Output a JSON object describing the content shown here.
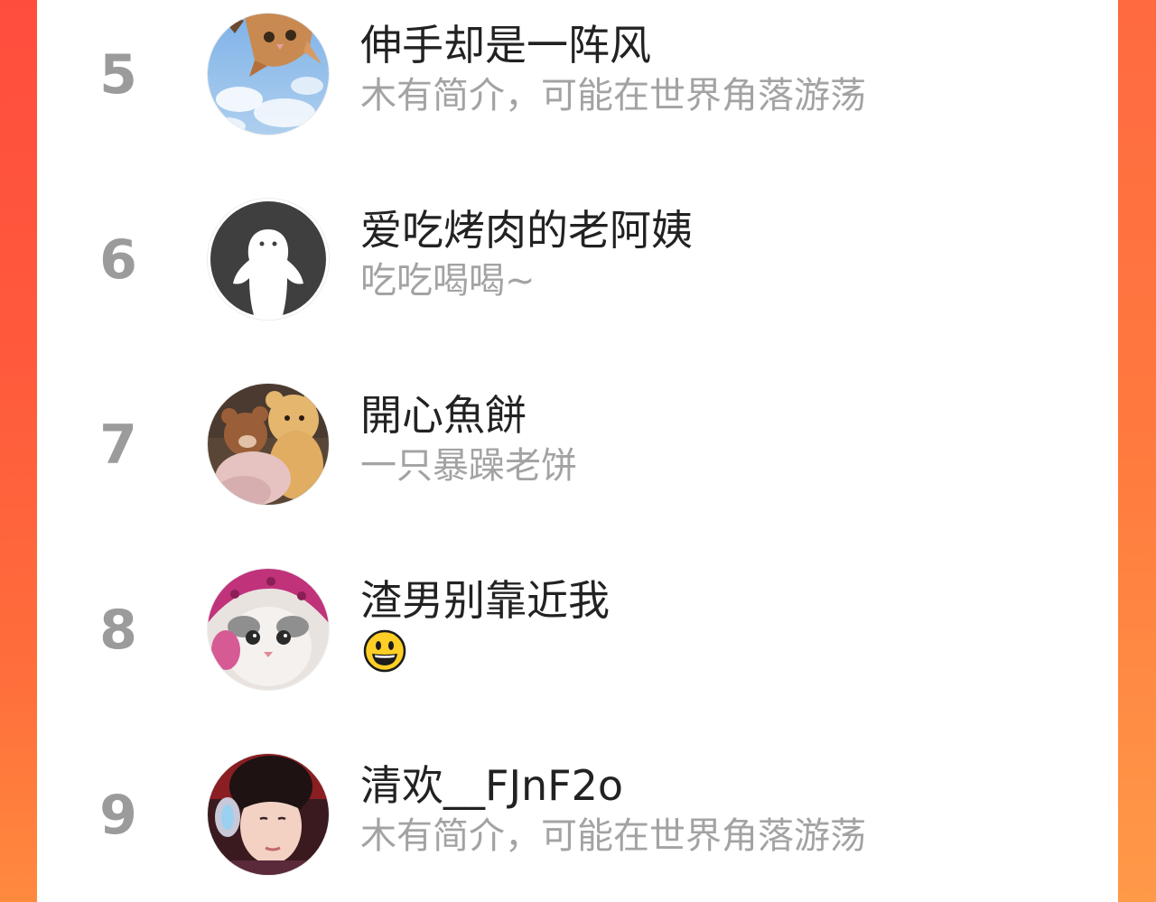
{
  "ranking": {
    "items": [
      {
        "rank": "5",
        "name": "伸手却是一阵风",
        "bio": "木有简介，可能在世界角落游荡",
        "avatar_icon": "cat-sky-avatar-icon"
      },
      {
        "rank": "6",
        "name": "爱吃烤肉的老阿姨",
        "bio": "吃吃喝喝~",
        "avatar_icon": "default-ghost-avatar-icon"
      },
      {
        "rank": "7",
        "name": "開心魚餅",
        "bio": "一只暴躁老饼",
        "avatar_icon": "teddy-bears-avatar-icon"
      },
      {
        "rank": "8",
        "name": "渣男别靠近我",
        "bio": "",
        "bio_emoji_icon": "grinning-face-emoji-icon",
        "avatar_icon": "cat-pink-hat-avatar-icon"
      },
      {
        "rank": "9",
        "name": "清欢__FJnF2o",
        "bio": "木有简介，可能在世界角落游荡",
        "avatar_icon": "girl-headphones-avatar-icon"
      }
    ]
  },
  "colors": {
    "accent_gradient_top": "#ff4d3d",
    "accent_gradient_bottom": "#ff8a3e",
    "rank_gray": "#9b9b9b",
    "name_text": "#222222",
    "bio_text": "#a3a3a3"
  }
}
